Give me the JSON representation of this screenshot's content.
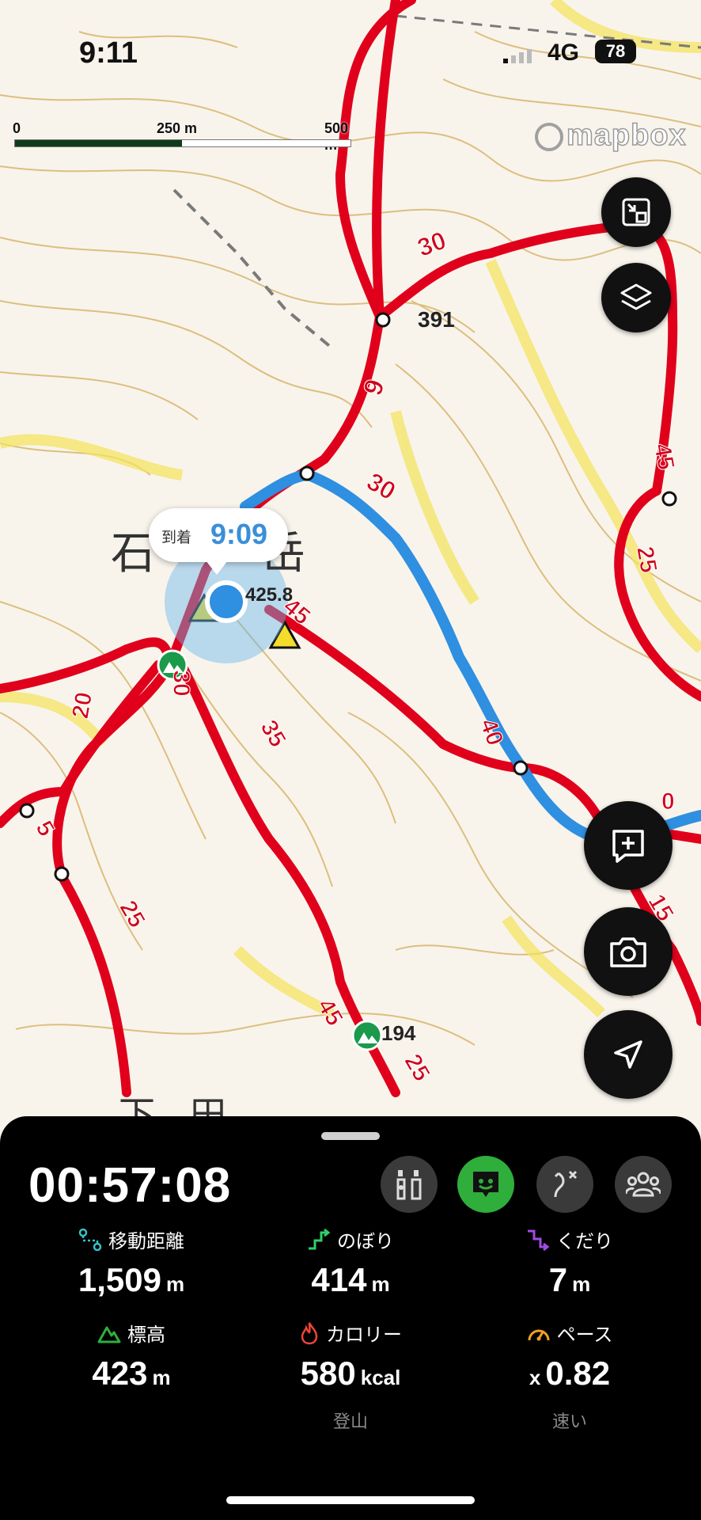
{
  "status_bar": {
    "time": "9:11",
    "network": "4G",
    "battery": "78"
  },
  "map": {
    "scale": {
      "labels": [
        "0",
        "250 m",
        "500 m"
      ]
    },
    "attribution": "mapbox",
    "arrival_bubble": {
      "label": "到着",
      "time": "9:09"
    },
    "place_labels": [
      "石",
      "岳",
      "下",
      "田"
    ],
    "spot_heights": [
      "391",
      "425.8",
      "194"
    ],
    "segment_times": [
      "30",
      "9",
      "30",
      "45",
      "25",
      "45",
      "35",
      "40",
      "30",
      "20",
      "5",
      "25",
      "45",
      "25",
      "15",
      "0"
    ],
    "colors": {
      "route_red": "#e0001b",
      "track_blue": "#2f8fe0",
      "contour": "#c8a04a",
      "accent_green": "#2fae3b"
    }
  },
  "controls": {
    "right": [
      {
        "name": "fit-map-button",
        "icon": "collapse-icon"
      },
      {
        "name": "layers-button",
        "icon": "layers-icon"
      },
      {
        "name": "add-memo-button",
        "icon": "memo-plus-icon"
      },
      {
        "name": "camera-button",
        "icon": "camera-icon"
      },
      {
        "name": "locate-button",
        "icon": "navigation-arrow-icon"
      }
    ]
  },
  "panel": {
    "elapsed": "00:57:08",
    "toggles": [
      {
        "name": "trail-info-toggle",
        "icon": "signpost-icon",
        "active": false
      },
      {
        "name": "chat-toggle",
        "icon": "chat-face-icon",
        "active": true
      },
      {
        "name": "route-toggle",
        "icon": "route-icon",
        "active": false
      },
      {
        "name": "group-toggle",
        "icon": "group-icon",
        "active": false
      }
    ],
    "stats": [
      {
        "label": "移動距離",
        "value": "1,509",
        "unit": "m",
        "icon": "distance-icon",
        "color": "#38c0c8"
      },
      {
        "label": "のぼり",
        "value": "414",
        "unit": "m",
        "icon": "ascent-icon",
        "color": "#2fcf6a"
      },
      {
        "label": "くだり",
        "value": "7",
        "unit": "m",
        "icon": "descent-icon",
        "color": "#a04ce0"
      },
      {
        "label": "標高",
        "value": "423",
        "unit": "m",
        "icon": "mountain-icon",
        "color": "#2fae3b"
      },
      {
        "label": "カロリー",
        "value": "580",
        "unit": "kcal",
        "icon": "flame-icon",
        "color": "#f0443a"
      },
      {
        "label": "ペース",
        "prefix": "x",
        "value": "0.82",
        "unit": "",
        "icon": "speedometer-icon",
        "color": "#f0a020"
      }
    ],
    "subtexts": [
      "登山",
      "速い"
    ]
  }
}
